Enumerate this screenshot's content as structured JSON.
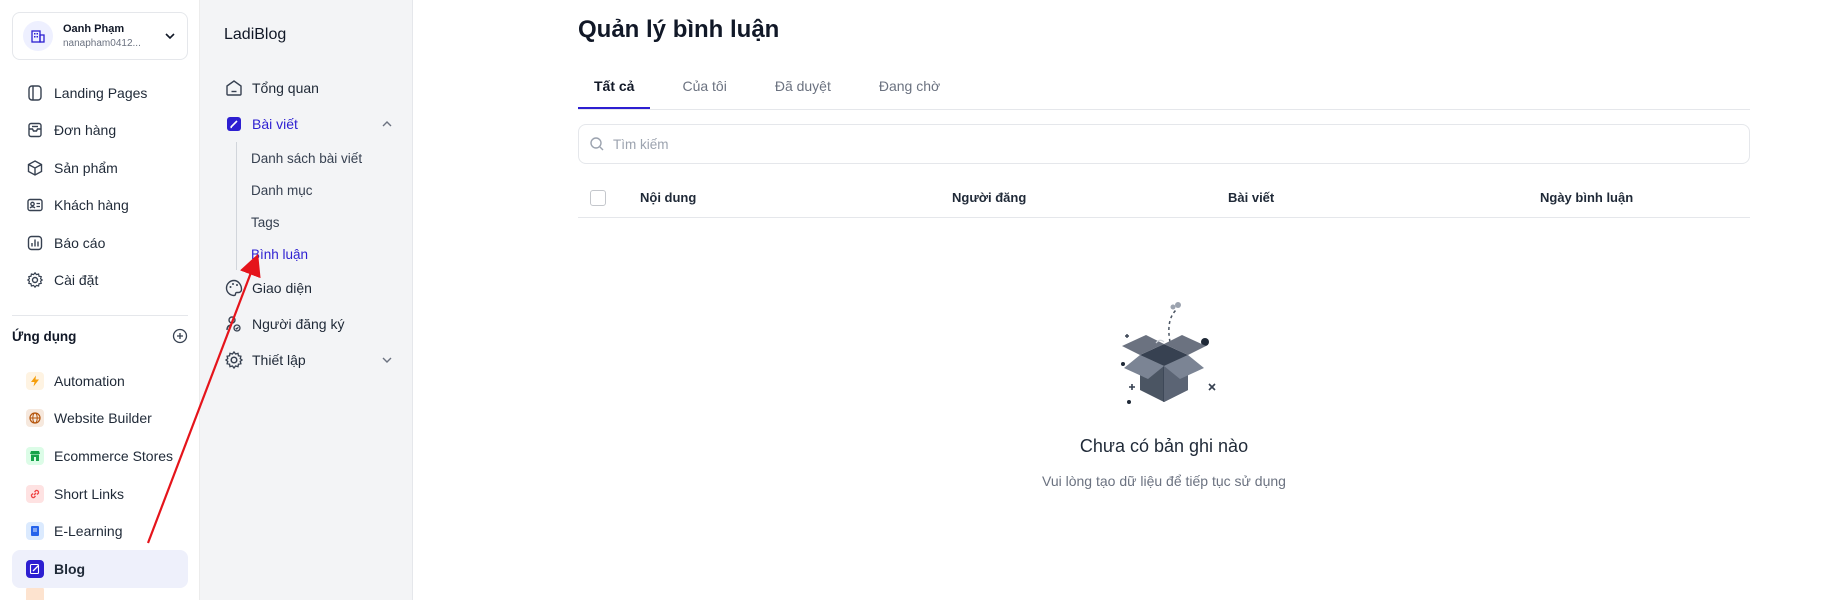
{
  "account": {
    "name": "Oanh Phạm",
    "email": "nanapham0412..."
  },
  "nav": [
    {
      "label": "Landing Pages",
      "icon": "landing-pages-icon"
    },
    {
      "label": "Đơn hàng",
      "icon": "orders-icon"
    },
    {
      "label": "Sản phẩm",
      "icon": "products-icon"
    },
    {
      "label": "Khách hàng",
      "icon": "customers-icon"
    },
    {
      "label": "Báo cáo",
      "icon": "reports-icon"
    },
    {
      "label": "Cài đặt",
      "icon": "settings-icon"
    }
  ],
  "apps": {
    "title": "Ứng dụng",
    "items": [
      {
        "label": "Automation",
        "color": "#f59e0b"
      },
      {
        "label": "Website Builder",
        "color": "#b45309"
      },
      {
        "label": "Ecommerce Stores",
        "color": "#16a34a"
      },
      {
        "label": "Short Links",
        "color": "#ef4444"
      },
      {
        "label": "E-Learning",
        "color": "#2563eb"
      },
      {
        "label": "Blog",
        "color": "#2d1fd1"
      }
    ]
  },
  "sub": {
    "title": "LadiBlog",
    "overview": "Tổng quan",
    "posts": "Bài viết",
    "children": [
      "Danh sách bài viết",
      "Danh mục",
      "Tags",
      "Bình luận"
    ],
    "theme": "Giao diện",
    "subscribers": "Người đăng ký",
    "setup": "Thiết lập"
  },
  "main": {
    "title": "Quản lý bình luận",
    "tabs": [
      "Tất cả",
      "Của tôi",
      "Đã duyệt",
      "Đang chờ"
    ],
    "search_placeholder": "Tìm kiếm",
    "columns": [
      "Nội dung",
      "Người đăng",
      "Bài viết",
      "Ngày bình luận"
    ],
    "empty_title": "Chưa có bản ghi nào",
    "empty_sub": "Vui lòng tạo dữ liệu để tiếp tục sử dụng"
  },
  "colors": {
    "accent": "#2d1fd1",
    "annotation": "#e5141b"
  }
}
